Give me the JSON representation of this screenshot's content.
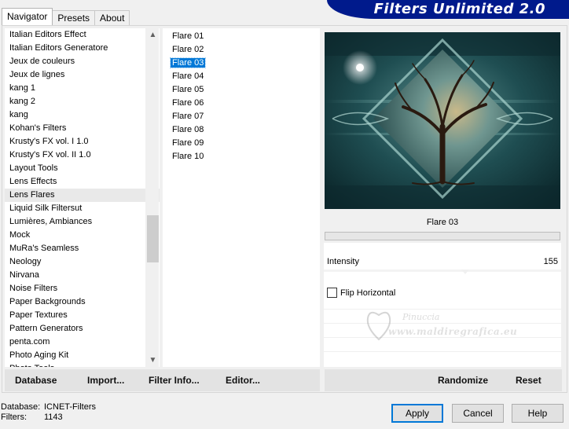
{
  "tabs": [
    {
      "label": "Navigator",
      "active": true
    },
    {
      "label": "Presets",
      "active": false
    },
    {
      "label": "About",
      "active": false
    }
  ],
  "banner_title": "Filters Unlimited 2.0",
  "categories": [
    "Italian Editors Effect",
    "Italian Editors Generatore",
    "Jeux de couleurs",
    "Jeux de lignes",
    "kang 1",
    "kang 2",
    "kang",
    "Kohan's Filters",
    "Krusty's FX vol. I 1.0",
    "Krusty's FX vol. II 1.0",
    "Layout Tools",
    "Lens Effects",
    "Lens Flares",
    "Liquid Silk Filtersut",
    "Lumières, Ambiances",
    "Mock",
    "MuRa's Seamless",
    "Neology",
    "Nirvana",
    "Noise Filters",
    "Paper Backgrounds",
    "Paper Textures",
    "Pattern Generators",
    "penta.com",
    "Photo Aging Kit",
    "Photo Tools"
  ],
  "selected_category": "Lens Flares",
  "filters": [
    "Flare 01",
    "Flare 02",
    "Flare 03",
    "Flare 04",
    "Flare 05",
    "Flare 06",
    "Flare 07",
    "Flare 08",
    "Flare 09",
    "Flare 10"
  ],
  "selected_filter": "Flare 03",
  "selected_filter_label": "Flare 03",
  "params": {
    "intensity_label": "Intensity",
    "intensity_value": "155",
    "flip_label": "Flip Horizontal",
    "flip_checked": false
  },
  "watermark": {
    "line1": "Pinuccia",
    "line2": "www.maldiregrafica.eu"
  },
  "left_buttons": {
    "database": "Database",
    "import": "Import...",
    "filter_info": "Filter Info...",
    "editor": "Editor..."
  },
  "right_buttons": {
    "randomize": "Randomize",
    "reset": "Reset"
  },
  "footer": {
    "database_key": "Database:",
    "database_value": "ICNET-Filters",
    "filters_key": "Filters:",
    "filters_value": "1143"
  },
  "dialog_buttons": {
    "apply": "Apply",
    "cancel": "Cancel",
    "help": "Help"
  },
  "colors": {
    "selection": "#0078d7",
    "banner": "#001a8c"
  }
}
